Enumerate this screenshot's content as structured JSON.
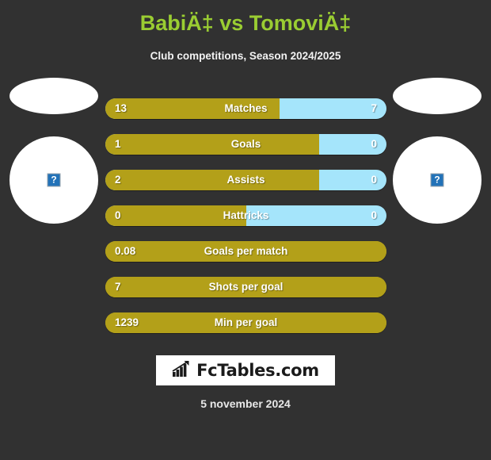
{
  "header": {
    "title": "BabiÄ‡ vs TomoviÄ‡",
    "subtitle": "Club competitions, Season 2024/2025",
    "title_color": "#9ACD32"
  },
  "players": {
    "left": {
      "photo_alt": "broken-image",
      "broken_glyph": "?"
    },
    "right": {
      "photo_alt": "broken-image",
      "broken_glyph": "?"
    }
  },
  "colors": {
    "background": "#313131",
    "home_bar": "#B3A019",
    "away_bar": "#A5E5FB",
    "text": "#ffffff"
  },
  "stats": [
    {
      "label": "Matches",
      "left": "13",
      "right": "7",
      "home_pct": 62,
      "two_sided": true
    },
    {
      "label": "Goals",
      "left": "1",
      "right": "0",
      "home_pct": 76,
      "two_sided": true
    },
    {
      "label": "Assists",
      "left": "2",
      "right": "0",
      "home_pct": 76,
      "two_sided": true
    },
    {
      "label": "Hattricks",
      "left": "0",
      "right": "0",
      "home_pct": 50,
      "two_sided": true
    },
    {
      "label": "Goals per match",
      "left": "0.08",
      "right": "",
      "home_pct": 100,
      "two_sided": false
    },
    {
      "label": "Shots per goal",
      "left": "7",
      "right": "",
      "home_pct": 100,
      "two_sided": false
    },
    {
      "label": "Min per goal",
      "left": "1239",
      "right": "",
      "home_pct": 100,
      "two_sided": false
    }
  ],
  "footer": {
    "logo_text": "FcTables.com",
    "logo_icon": "bar-chart-arrow-icon",
    "date": "5 november 2024"
  }
}
